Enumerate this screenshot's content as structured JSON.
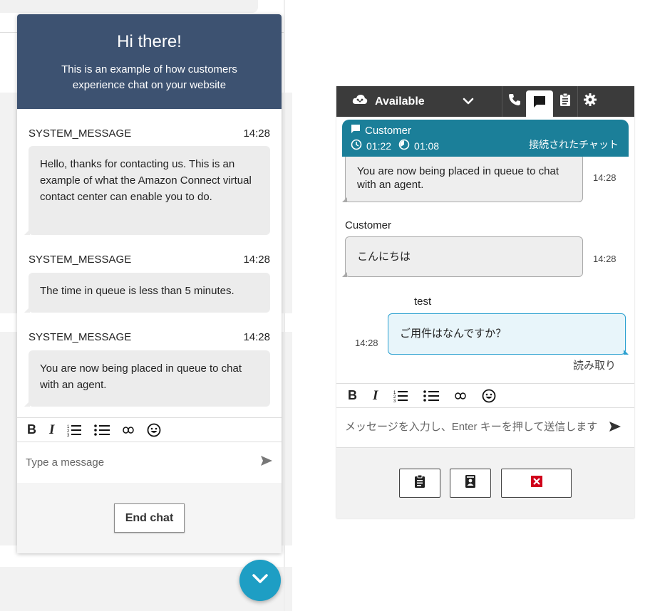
{
  "widget": {
    "title": "Hi there!",
    "subtitle": "This is an example of how customers experience chat on your website",
    "messages": [
      {
        "sender": "SYSTEM_MESSAGE",
        "time": "14:28",
        "text": "Hello, thanks for contacting us. This is an example of what the Amazon Connect virtual contact center can enable you to do."
      },
      {
        "sender": "SYSTEM_MESSAGE",
        "time": "14:28",
        "text": "The time in queue is less than 5 minutes."
      },
      {
        "sender": "SYSTEM_MESSAGE",
        "time": "14:28",
        "text": "You are now being placed in queue to chat with an agent."
      }
    ],
    "toolbar": [
      "bold-icon",
      "italic-icon",
      "numbered-list-icon",
      "bullet-list-icon",
      "link-icon",
      "emoji-icon"
    ],
    "input_placeholder": "Type a message",
    "end_chat_label": "End chat"
  },
  "ccp": {
    "status": "Available",
    "contact": {
      "name": "Customer",
      "timer_total": "01:22",
      "timer_state": "01:08",
      "state": "接続されたチャット"
    },
    "messages": [
      {
        "text": "You are now being placed in queue to chat with an agent.",
        "time": "14:28"
      },
      {
        "sender": "Customer",
        "text": "こんにちは",
        "time": "14:28"
      },
      {
        "sender": "test",
        "text": "ご用件はなんですか？",
        "time": "14:28",
        "receipt": "読み取り"
      }
    ],
    "input_placeholder": "メッセージを入力し、Enter キーを押して送信します",
    "colors": {
      "header": "#3b3b3b",
      "contact_bar": "#1b7f99",
      "agent_bubble_border": "#2aa0d0",
      "end_contact": "#d0021b"
    }
  }
}
